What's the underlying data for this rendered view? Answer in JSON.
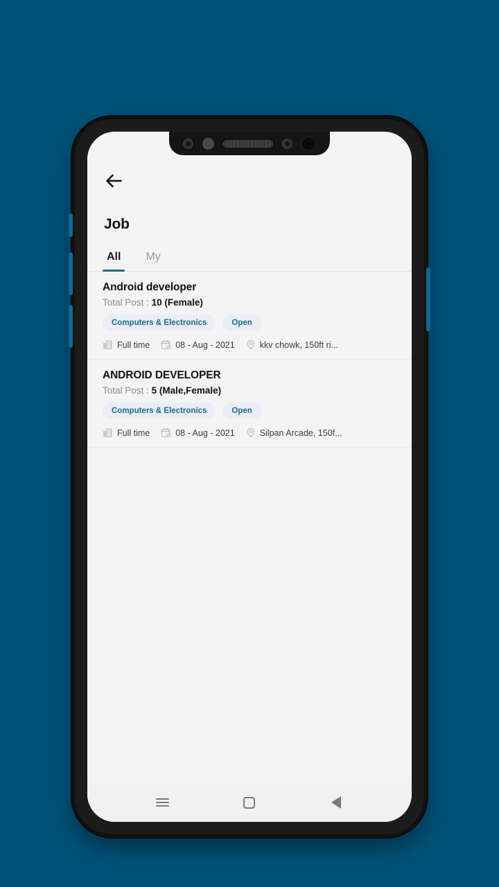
{
  "theme": {
    "page_background": "#005278",
    "screen_background": "#f4f4f4",
    "accent": "#1d6b8c",
    "chip_background": "#eaecf6",
    "chip_text": "#1d6b8c",
    "title_text": "#111111",
    "muted_text": "#8e8e8e"
  },
  "appbar": {
    "back_icon": "arrow-left-icon",
    "title": "Job"
  },
  "tabs": [
    {
      "label": "All",
      "active": true
    },
    {
      "label": "My",
      "active": false
    }
  ],
  "jobs": [
    {
      "title": "Android developer",
      "post_label": "Total Post :",
      "post_value": "10 (Female)",
      "chips": [
        "Computers & Electronics",
        "Open"
      ],
      "employment_type": "Full time",
      "employment_icon": "office-building-icon",
      "date": "08 - Aug - 2021",
      "date_icon": "calendar-clock-icon",
      "location": "kkv chowk, 150ft ri...",
      "location_icon": "map-pin-icon"
    },
    {
      "title": "ANDROID DEVELOPER",
      "post_label": "Total Post :",
      "post_value": "5 (Male,Female)",
      "chips": [
        "Computers & Electronics",
        "Open"
      ],
      "employment_type": "Full time",
      "employment_icon": "office-building-icon",
      "date": "08 - Aug - 2021",
      "date_icon": "calendar-clock-icon",
      "location": "Silpan Arcade, 150f...",
      "location_icon": "map-pin-icon"
    }
  ],
  "navbar": {
    "recents_label": "recents-icon",
    "home_label": "home-icon",
    "back_label": "back-icon"
  },
  "notch": {
    "items": [
      "front-camera-icon",
      "sensor-dot-icon",
      "earpiece-speaker-icon",
      "secondary-camera-icon",
      "proximity-sensor-icon"
    ]
  }
}
